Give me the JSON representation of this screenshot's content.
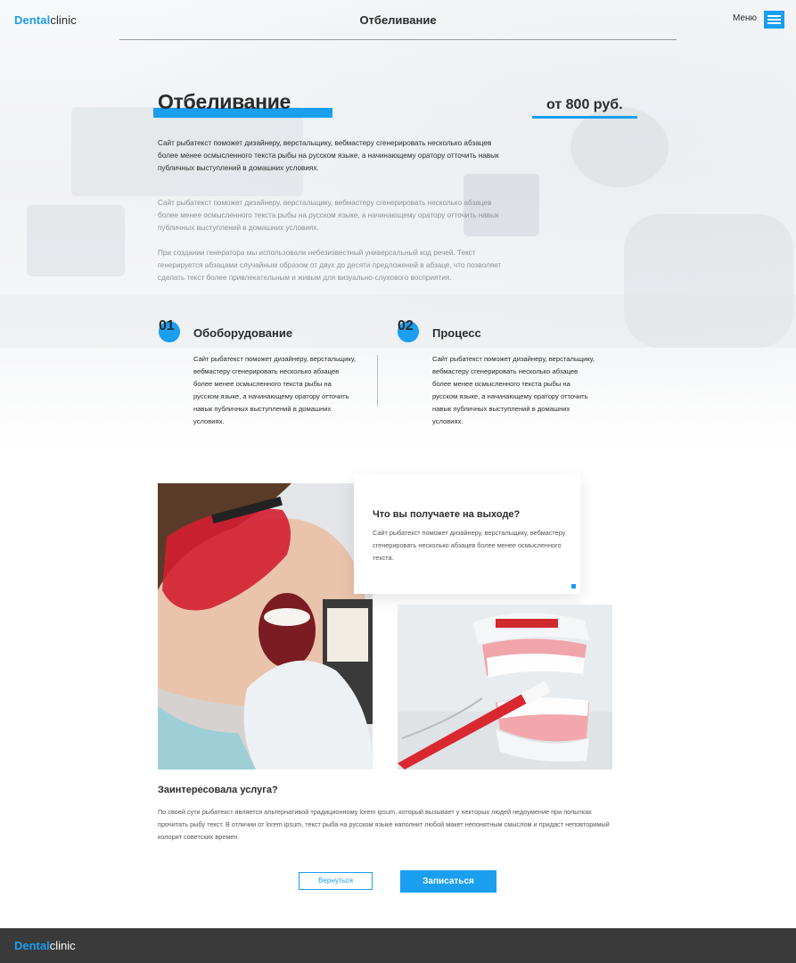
{
  "brand": {
    "logo_part1": "Dental",
    "logo_part2": "clinic"
  },
  "header": {
    "title": "Отбеливание",
    "menu_label": "Меню"
  },
  "hero": {
    "heading": "Отбеливание",
    "price": "от 800 руб.",
    "paragraphs": [
      "Сайт рыбатекст поможет дизайнеру, верстальщику, вебмастеру сгенерировать несколько абзацев более менее осмысленного текста рыбы на русском языке, а начинающему оратору отточить навык публичных выступлений в домашних условиях.",
      "Сайт рыбатекст поможет дизайнеру, верстальщику, вебмастеру сгенерировать несколько абзацев более менее осмысленного текста рыбы на русском языке, а начинающему оратору отточить навык публичных выступлений в домашних условиях.",
      "При создании генератора мы использовали небезизвестный универсальный код речей. Текст генерируется абзацами случайным образом от двух до десяти предложений в абзаце, что позволяет сделать текст более привлекательным и живым для визуально-слухового восприятия."
    ]
  },
  "features": [
    {
      "number": "01",
      "title": "Обоборудование",
      "text": "Сайт рыбатекст поможет дизайнеру, верстальщику, вебмастеру сгенерировать несколько абзацев более менее осмысленного текста рыбы на русском языке, а начинающему оратору отточить навык публичных выступлений в домашних условиях."
    },
    {
      "number": "02",
      "title": "Процесс",
      "text": "Сайт рыбатекст поможет дизайнеру, верстальщику, вебмастеру сгенерировать несколько абзацев более менее осмысленного текста рыбы на русском языке, а начинающему оратору отточить навык публичных выступлений в домашних условиях."
    }
  ],
  "result_card": {
    "title": "Что вы получаете на выходе?",
    "text": "Сайт рыбатекст поможет дизайнеру, верстальщику, вебмастеру сгенерировать несколько абзацев более менее осмысленного текста."
  },
  "interest": {
    "title": "Заинтересовала услуга?",
    "text": "По своей сути рыбатекст является альтернативой традиционному lorem ipsum, который вызывает у некторых людей недоумение при попытках прочитать рыбу текст. В отличии от lorem ipsum, текст рыба на русском языке наполнит любой макет непонятным смыслом и придаст неповторимый колорит советских времен."
  },
  "actions": {
    "back_label": "Вернуться",
    "book_label": "Записаться"
  },
  "colors": {
    "accent": "#1a9ef0",
    "text": "#2b2b2b",
    "footer_bg": "#3a3a3a"
  },
  "icons": {
    "menu": "hamburger-icon"
  }
}
